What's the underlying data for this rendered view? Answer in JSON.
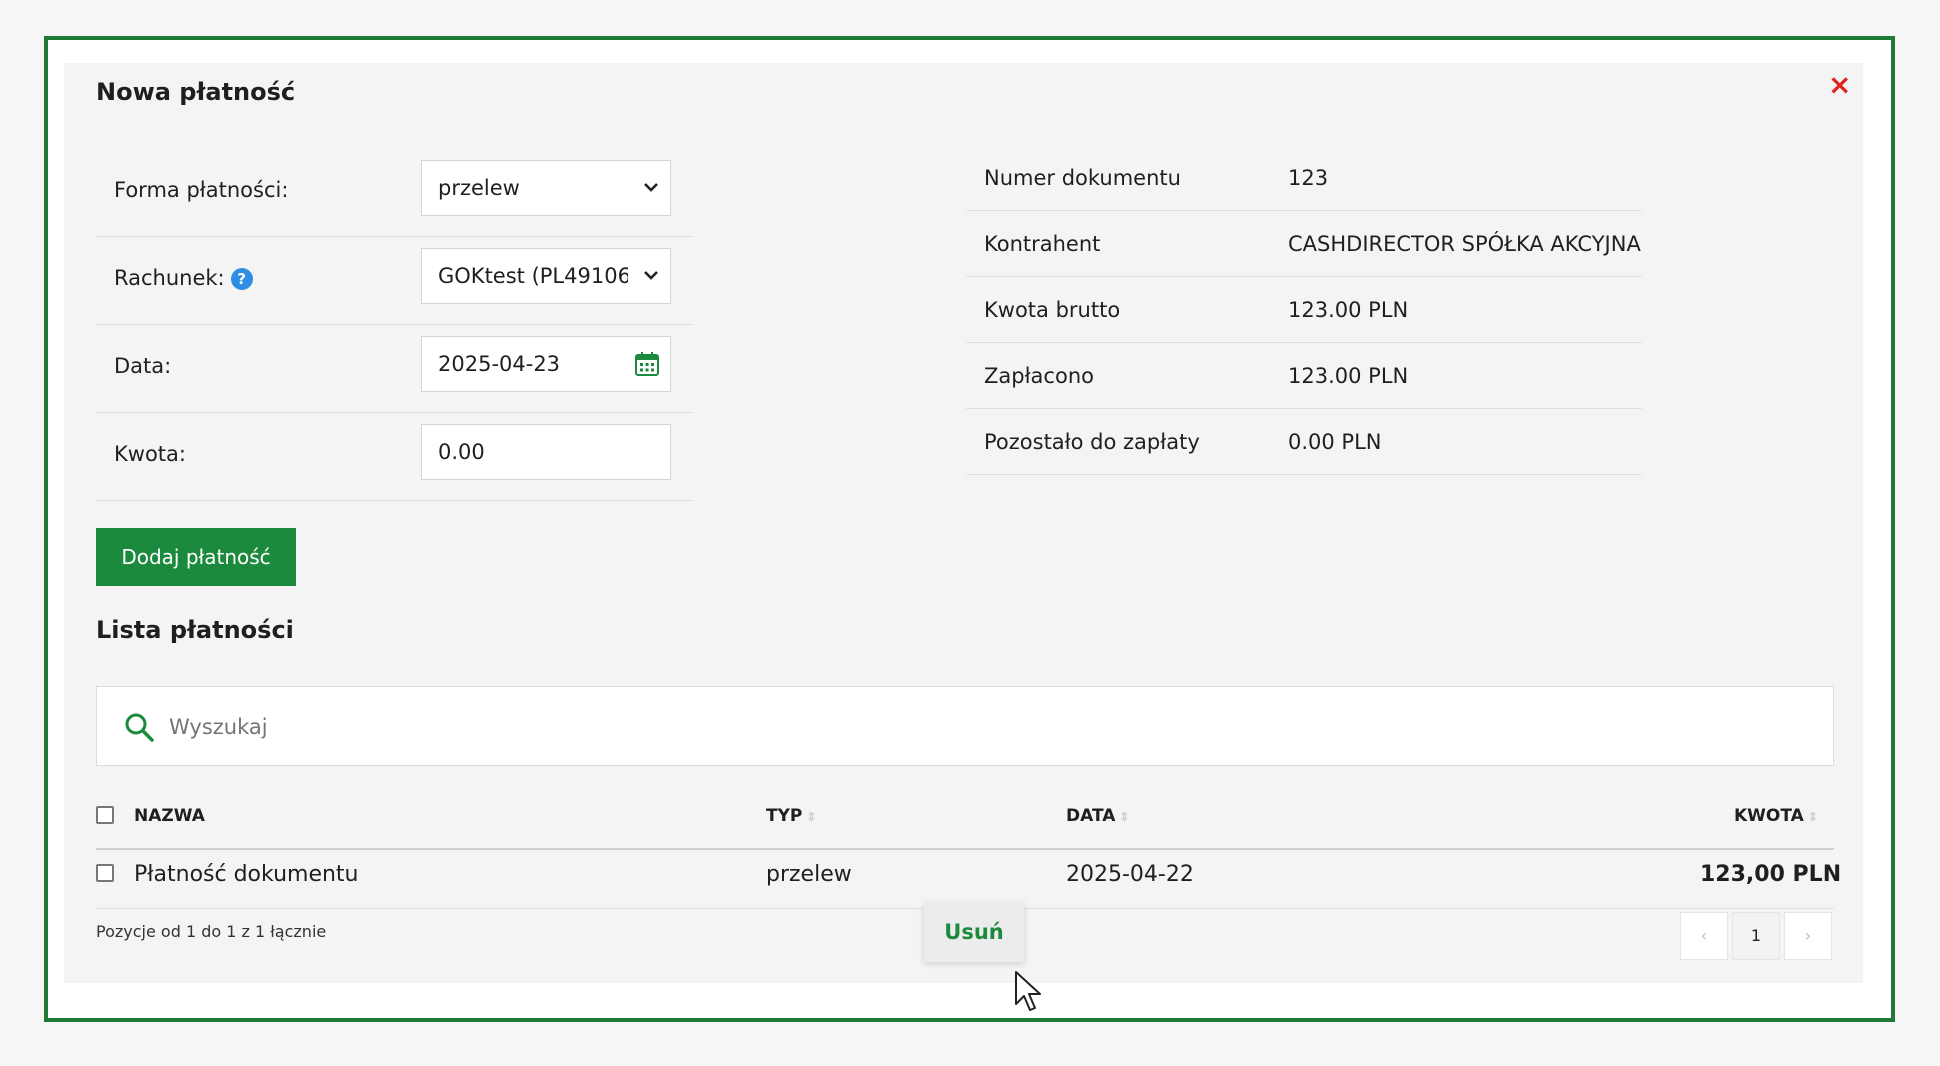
{
  "modal": {
    "title": "Nowa płatność",
    "close": "×"
  },
  "form": {
    "payment_form": {
      "label": "Forma płatności:",
      "value": "przelew"
    },
    "account": {
      "label": "Rachunek:",
      "value": "GOKtest (PL49106("
    },
    "date": {
      "label": "Data:",
      "value": "2025-04-23"
    },
    "amount": {
      "label": "Kwota:",
      "value": "0.00"
    },
    "add_button": "Dodaj płatność"
  },
  "doc_info": [
    {
      "label": "Numer dokumentu",
      "value": "123"
    },
    {
      "label": "Kontrahent",
      "value": "CASHDIRECTOR SPÓŁKA AKCYJNA"
    },
    {
      "label": "Kwota brutto",
      "value": "123.00 PLN"
    },
    {
      "label": "Zapłacono",
      "value": "123.00 PLN"
    },
    {
      "label": "Pozostało do zapłaty",
      "value": "0.00 PLN"
    }
  ],
  "list": {
    "title": "Lista płatności",
    "search_placeholder": "Wyszukaj",
    "columns": {
      "name": "NAZWA",
      "type": "TYP",
      "date": "DATA",
      "amount": "KWOTA"
    },
    "rows": [
      {
        "name": "Płatność dokumentu",
        "type": "przelew",
        "date": "2025-04-22",
        "amount": "123,00 PLN"
      }
    ],
    "footer_info": "Pozycje od 1 do 1 z 1 łącznie",
    "delete_button": "Usuń",
    "pagination": {
      "prev": "‹",
      "current": "1",
      "next": "›"
    }
  },
  "colors": {
    "accent_green": "#1b8a3c",
    "frame_green": "#1e7a34",
    "close_red": "#e0231c",
    "help_blue": "#2f8de4"
  }
}
